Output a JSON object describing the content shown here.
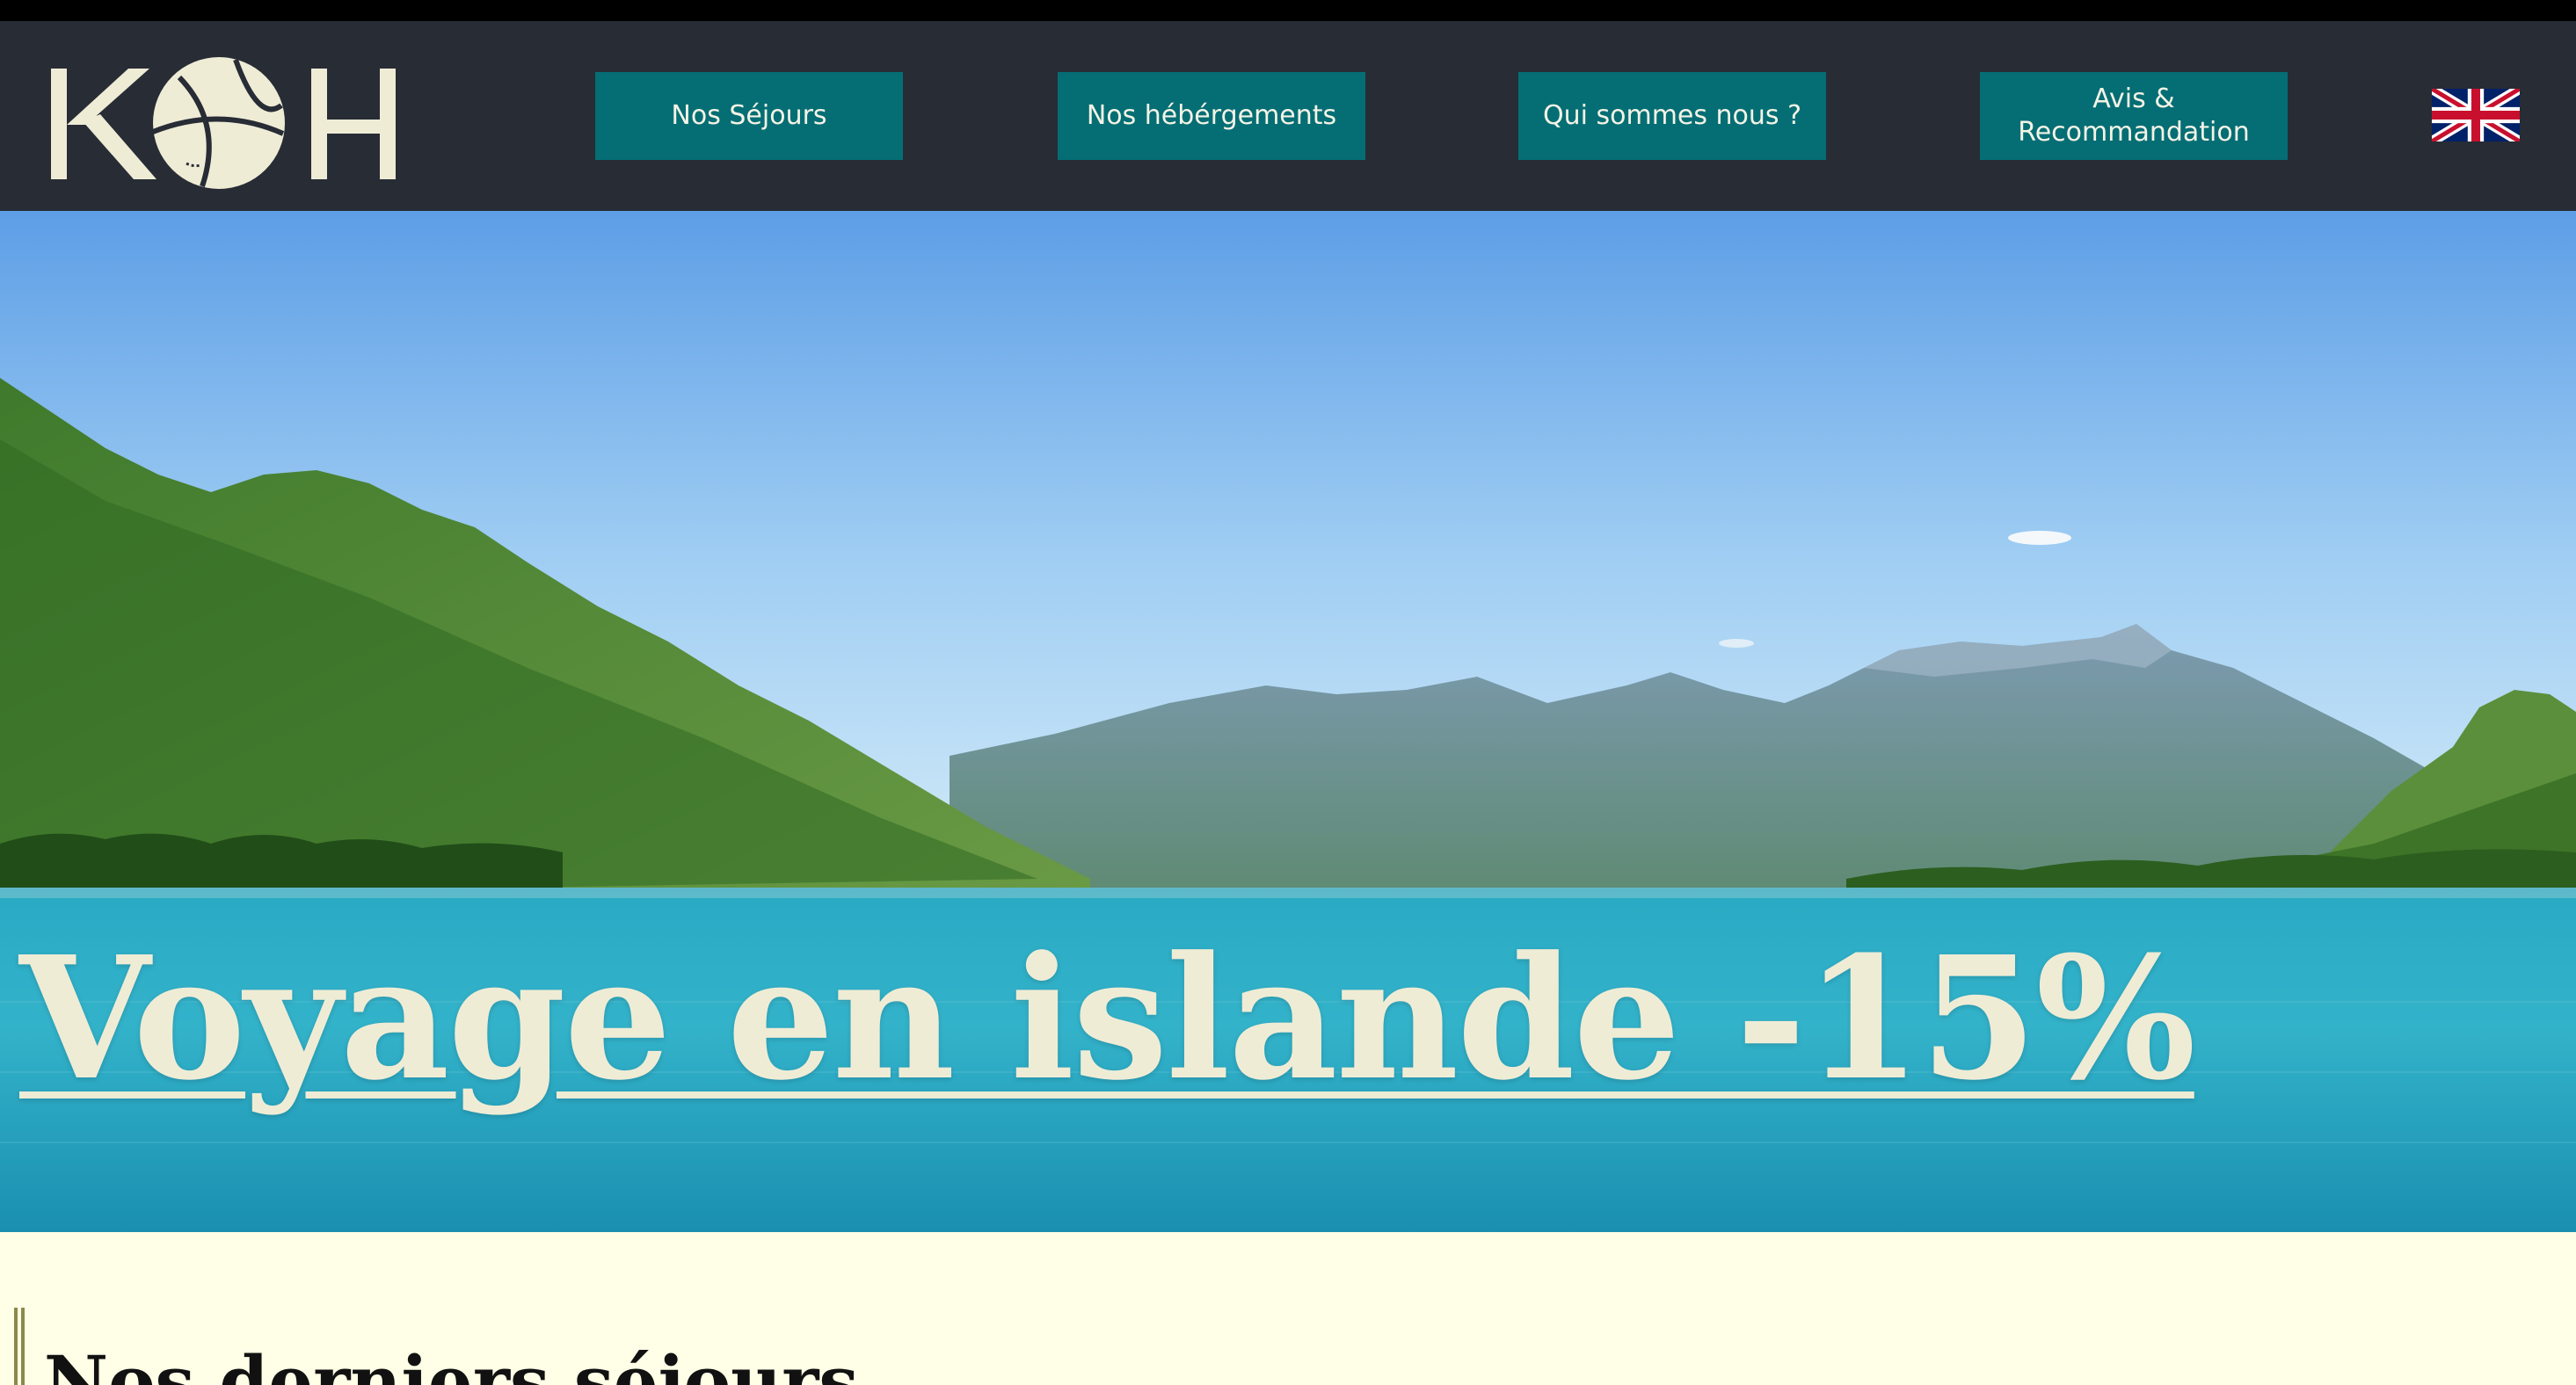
{
  "header": {
    "logo_alt": "KOH",
    "nav": [
      {
        "label": "Nos Séjours"
      },
      {
        "label": "Nos hébérgements"
      },
      {
        "label": "Qui sommes nous ?"
      },
      {
        "label": "Avis & Recommandation"
      }
    ],
    "language_flag": "uk-flag-icon"
  },
  "hero": {
    "title": "Voyage en islande -15%"
  },
  "section": {
    "title": "Nos derniers séjours"
  },
  "colors": {
    "nav_background": "#272c35",
    "button_background": "#046e74",
    "button_text": "#f4f3e6",
    "page_background": "#fffee6",
    "hero_title": "#efecd6"
  }
}
